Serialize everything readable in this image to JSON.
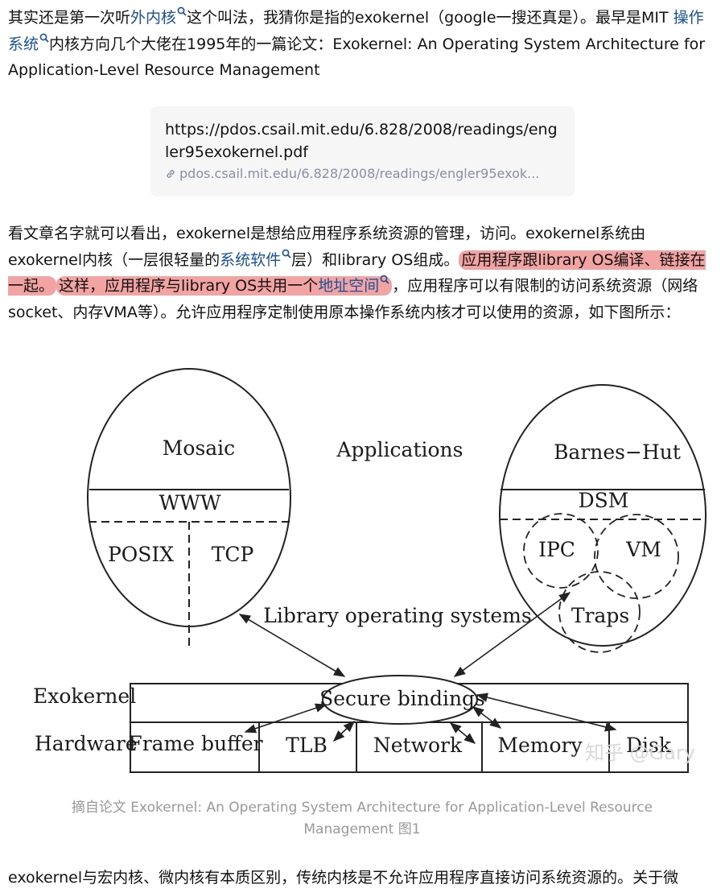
{
  "p1": {
    "t1": "其实还是第一次听",
    "kw1": "外内核",
    "t2": "这个叫法，我猜你是指的exokernel（google一搜还真是）。最早是MIT ",
    "kw2": "操作系统",
    "t3": "内核方向几个大佬在1995年的一篇论文：Exokernel: An Operating System Architecture for Application-Level Resource Management"
  },
  "link_card": {
    "title": "https://pdos.csail.mit.edu/6.828/2008/readings/engler95exokernel.pdf",
    "url": "pdos.csail.mit.edu/6.828/2008/readings/engler95exok..."
  },
  "p2": {
    "t1": "看文章名字就可以看出，exokernel是想给应用程序系统资源的管理，访问。exokernel系统由exokernel内核（一层很轻量的",
    "kw1": "系统软件",
    "t2": "层）和library OS组成。",
    "hl1": "应用程序跟library OS编译、链接在一起。",
    "hl2a": "这样，应用程序与library OS共用一个",
    "kw2": "地址空间",
    "t3": "，应用程序可以有限制的访问系统资源（网络socket、内存VMA等）。允许应用程序定制使用原本操作系统内核才可以使用的资源，如下图所示："
  },
  "figure": {
    "mosaic": "Mosaic",
    "www": "WWW",
    "posix": "POSIX",
    "tcp": "TCP",
    "applications": "Applications",
    "barnes_hut": "Barnes−Hut",
    "dsm": "DSM",
    "ipc": "IPC",
    "vm": "VM",
    "traps": "Traps",
    "libos": "Library operating systems",
    "exokernel": "Exokernel",
    "secure_bindings": "Secure bindings",
    "hardware": "Hardware",
    "frame_buffer": "Frame buffer",
    "tlb": "TLB",
    "network": "Network",
    "memory": "Memory",
    "disk": "Disk",
    "watermark": "知乎 @Gary"
  },
  "caption": "摘自论文 Exokernel: An Operating System Architecture for Application-Level Resource Management 图1",
  "p3": {
    "t1": "exokernel与宏内核、微内核有本质区别，传统内核是不允许应用程序直接访问系统资源的。关于微"
  },
  "icons": {
    "search": "search-icon",
    "link": "link-icon"
  },
  "colors": {
    "keyword": "#175199",
    "highlight": "#f4a3a3",
    "caption": "#999999"
  }
}
